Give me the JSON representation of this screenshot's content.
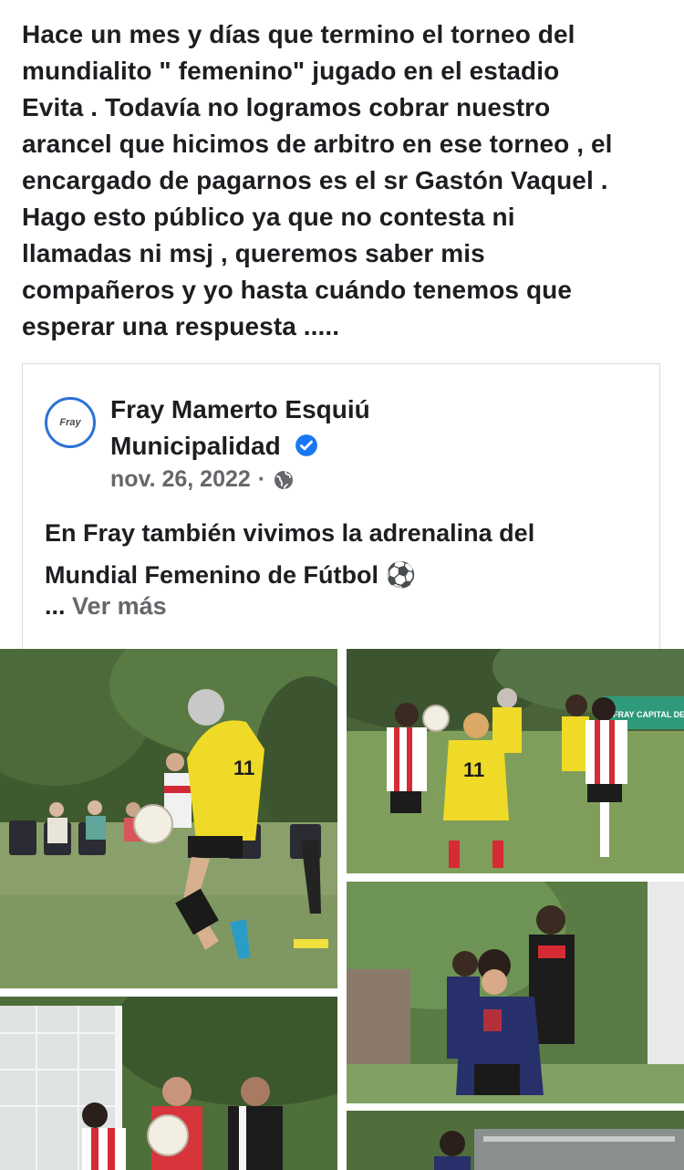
{
  "post": {
    "lines": [
      "Hace un mes y días que termino el torneo del",
      "mundialito  \" femenino\" jugado en el estadio",
      "Evita . Todavía no logramos cobrar nuestro",
      "arancel que hicimos de arbitro en ese torneo , el",
      "encargado de pagarnos es el sr Gastón Vaquel .",
      "Hago esto público ya que no contesta ni",
      "llamadas ni msj , queremos saber mis",
      "compañeros y yo hasta cuándo tenemos que",
      "esperar una respuesta ....."
    ]
  },
  "shared": {
    "avatar_text": "Fray",
    "page_name_line1": "Fray Mamerto Esquiú",
    "page_name_line2": "Municipalidad",
    "date": "nov. 26, 2022",
    "separator": "·",
    "body_line1": "En Fray también vivimos la adrenalina del",
    "body_line2": "Mundial Femenino de Fútbol ⚽",
    "see_more_dots": "...",
    "see_more": "Ver más",
    "photo_banner_text": "FRAY CAPITAL DE",
    "jersey_number_1": "11",
    "jersey_number_2": "11"
  },
  "icons": {
    "verified": "verified-badge-icon",
    "audience": "globe-icon",
    "ball": "soccer-ball-emoji"
  },
  "colors": {
    "text": "#1c1e21",
    "secondary": "#65676b",
    "accent": "#2b72d6",
    "verified": "#1877f2",
    "border": "#d9dce1"
  }
}
